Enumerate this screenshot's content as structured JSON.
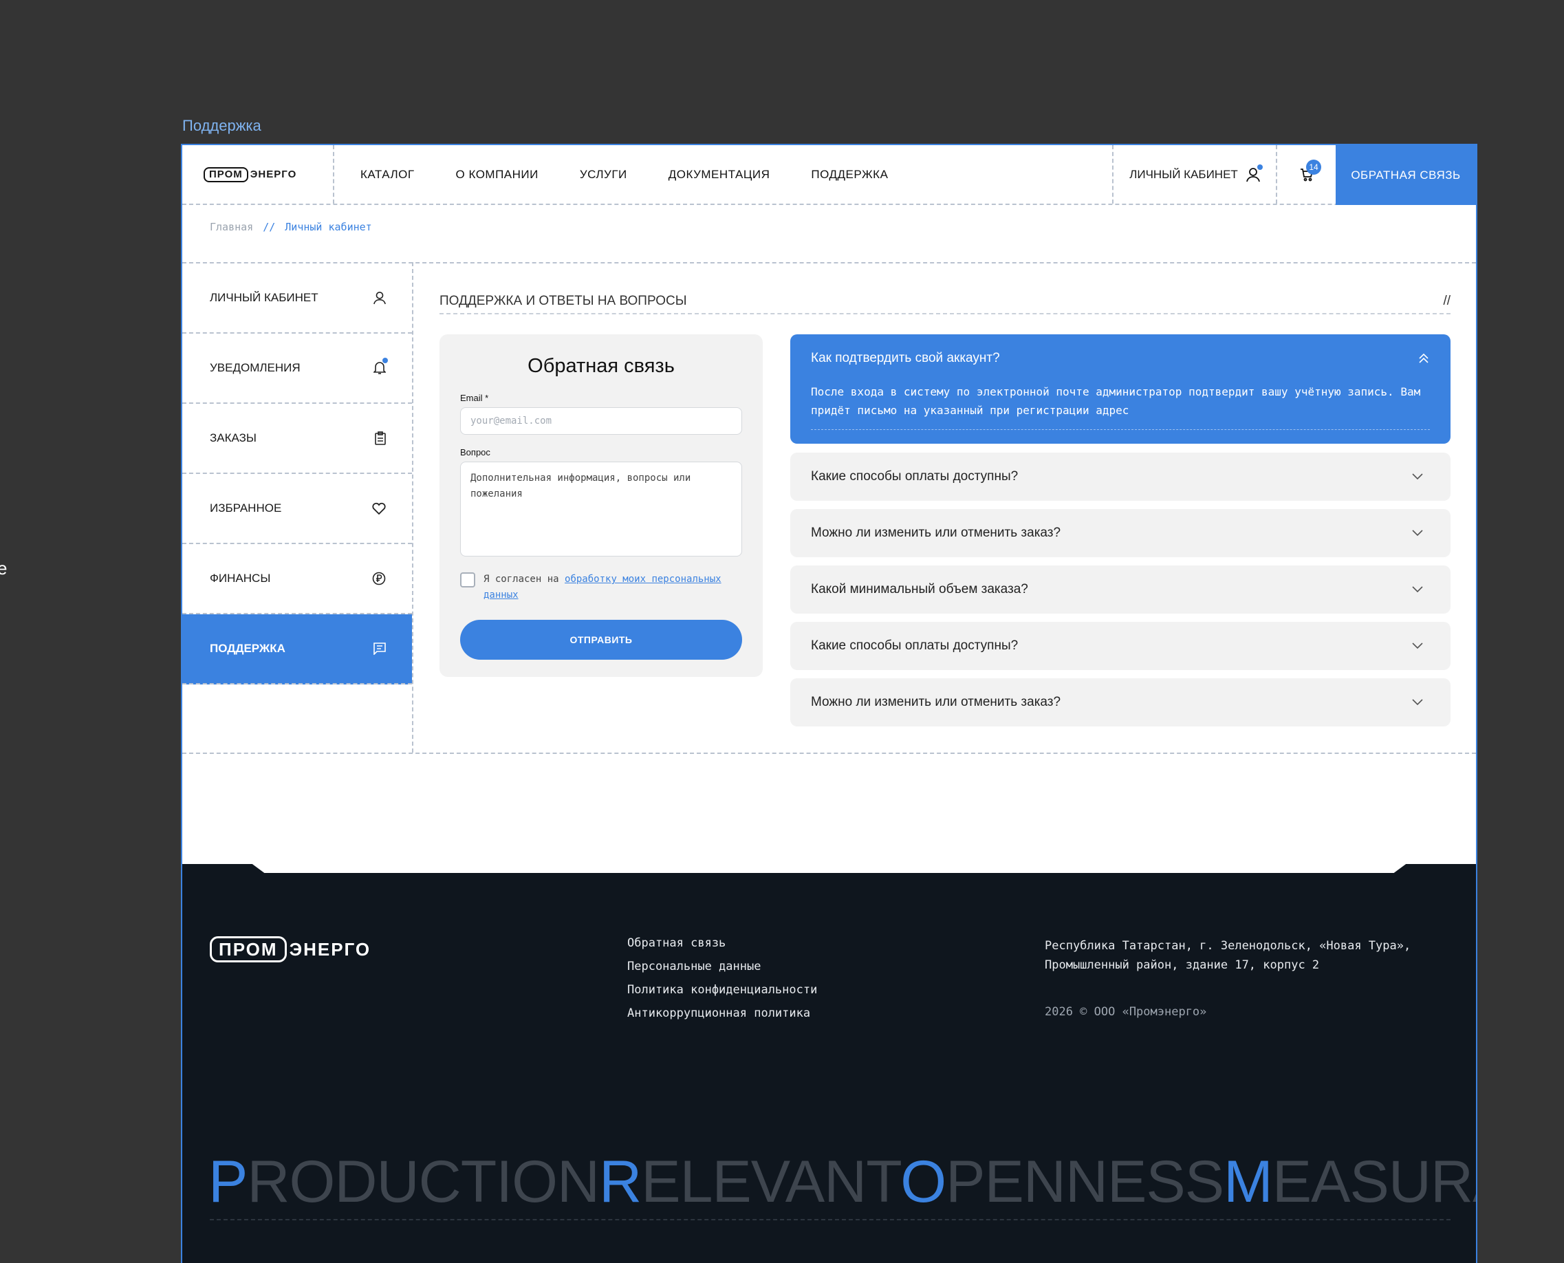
{
  "frame_label": "Поддержка",
  "edge_glyph": "e",
  "header": {
    "logo_box": "ПРОМ",
    "logo_rest": "ЭНЕРГО",
    "nav": [
      "КАТАЛОГ",
      "О КОМПАНИИ",
      "УСЛУГИ",
      "ДОКУМЕНТАЦИЯ",
      "ПОДДЕРЖКА"
    ],
    "account_label": "ЛИЧНЫЙ КАБИНЕТ",
    "cart_count": "14",
    "cta_label": "ОБРАТНАЯ СВЯЗЬ"
  },
  "breadcrumb": {
    "home": "Главная",
    "sep": "//",
    "current": "Личный кабинет"
  },
  "sidebar": {
    "items": [
      {
        "label": "ЛИЧНЫЙ КАБИНЕТ",
        "icon": "user-icon"
      },
      {
        "label": "УВЕДОМЛЕНИЯ",
        "icon": "bell-icon"
      },
      {
        "label": "ЗАКАЗЫ",
        "icon": "clipboard-icon"
      },
      {
        "label": "ИЗБРАННОЕ",
        "icon": "heart-icon"
      },
      {
        "label": "ФИНАНСЫ",
        "icon": "ruble-icon"
      },
      {
        "label": "ПОДДЕРЖКА",
        "icon": "message-icon"
      }
    ]
  },
  "section": {
    "title": "ПОДДЕРЖКА И ОТВЕТЫ НА ВОПРОСЫ",
    "mark": "//"
  },
  "form": {
    "title": "Обратная связь",
    "email_label": "Email *",
    "email_placeholder": "your@email.com",
    "question_label": "Вопрос",
    "question_placeholder": "Дополнительная информация, вопросы или пожелания",
    "agree_prefix": "Я согласен на",
    "agree_link": "обработку моих персональных данных",
    "submit_label": "ОТПРАВИТЬ"
  },
  "faq": {
    "open": {
      "question": "Как подтвердить свой аккаунт?",
      "answer": "После входа в систему по электронной почте администратор подтвердит вашу учётную запись. Вам придёт письмо на указанный при регистрации адрес"
    },
    "items": [
      "Какие способы оплаты доступны?",
      "Можно ли изменить или отменить заказ?",
      "Какой минимальный объем заказа?",
      "Какие способы оплаты доступны?",
      "Можно ли изменить или отменить заказ?"
    ]
  },
  "footer": {
    "logo_box": "ПРОМ",
    "logo_rest": "ЭНЕРГО",
    "links": [
      "Обратная связь",
      "Персональные данные",
      "Политика конфиденциальности",
      "Антикоррупционная политика"
    ],
    "address": "Республика Татарстан, г. Зеленодольск, «Новая Тура», Промышленный район, здание 17, корпус 2",
    "copyright": "2026 © ООО «Промэнерго»",
    "slogan": [
      {
        "first": "P",
        "rest": "RODUCTION"
      },
      {
        "first": "R",
        "rest": "ELEVANT"
      },
      {
        "first": "O",
        "rest": "PENNESS"
      },
      {
        "first": "M",
        "rest": "EASURABLE"
      }
    ]
  },
  "colors": {
    "accent": "#3b82e0",
    "page_bg": "#343434",
    "footer_bg": "#0f161e",
    "card_bg": "#f2f2f2"
  }
}
